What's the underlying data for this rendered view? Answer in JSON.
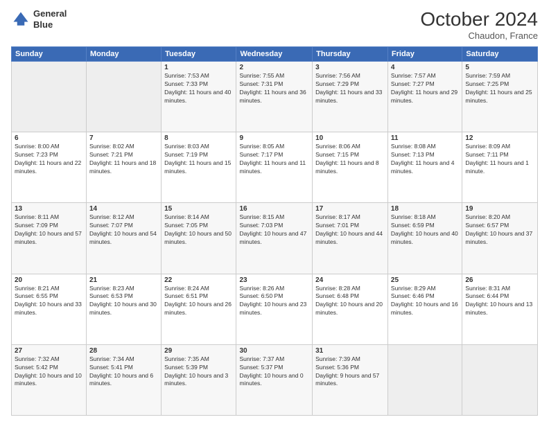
{
  "logo": {
    "line1": "General",
    "line2": "Blue"
  },
  "title": "October 2024",
  "location": "Chaudon, France",
  "days_header": [
    "Sunday",
    "Monday",
    "Tuesday",
    "Wednesday",
    "Thursday",
    "Friday",
    "Saturday"
  ],
  "weeks": [
    [
      {
        "day": "",
        "sunrise": "",
        "sunset": "",
        "daylight": ""
      },
      {
        "day": "",
        "sunrise": "",
        "sunset": "",
        "daylight": ""
      },
      {
        "day": "1",
        "sunrise": "Sunrise: 7:53 AM",
        "sunset": "Sunset: 7:33 PM",
        "daylight": "Daylight: 11 hours and 40 minutes."
      },
      {
        "day": "2",
        "sunrise": "Sunrise: 7:55 AM",
        "sunset": "Sunset: 7:31 PM",
        "daylight": "Daylight: 11 hours and 36 minutes."
      },
      {
        "day": "3",
        "sunrise": "Sunrise: 7:56 AM",
        "sunset": "Sunset: 7:29 PM",
        "daylight": "Daylight: 11 hours and 33 minutes."
      },
      {
        "day": "4",
        "sunrise": "Sunrise: 7:57 AM",
        "sunset": "Sunset: 7:27 PM",
        "daylight": "Daylight: 11 hours and 29 minutes."
      },
      {
        "day": "5",
        "sunrise": "Sunrise: 7:59 AM",
        "sunset": "Sunset: 7:25 PM",
        "daylight": "Daylight: 11 hours and 25 minutes."
      }
    ],
    [
      {
        "day": "6",
        "sunrise": "Sunrise: 8:00 AM",
        "sunset": "Sunset: 7:23 PM",
        "daylight": "Daylight: 11 hours and 22 minutes."
      },
      {
        "day": "7",
        "sunrise": "Sunrise: 8:02 AM",
        "sunset": "Sunset: 7:21 PM",
        "daylight": "Daylight: 11 hours and 18 minutes."
      },
      {
        "day": "8",
        "sunrise": "Sunrise: 8:03 AM",
        "sunset": "Sunset: 7:19 PM",
        "daylight": "Daylight: 11 hours and 15 minutes."
      },
      {
        "day": "9",
        "sunrise": "Sunrise: 8:05 AM",
        "sunset": "Sunset: 7:17 PM",
        "daylight": "Daylight: 11 hours and 11 minutes."
      },
      {
        "day": "10",
        "sunrise": "Sunrise: 8:06 AM",
        "sunset": "Sunset: 7:15 PM",
        "daylight": "Daylight: 11 hours and 8 minutes."
      },
      {
        "day": "11",
        "sunrise": "Sunrise: 8:08 AM",
        "sunset": "Sunset: 7:13 PM",
        "daylight": "Daylight: 11 hours and 4 minutes."
      },
      {
        "day": "12",
        "sunrise": "Sunrise: 8:09 AM",
        "sunset": "Sunset: 7:11 PM",
        "daylight": "Daylight: 11 hours and 1 minute."
      }
    ],
    [
      {
        "day": "13",
        "sunrise": "Sunrise: 8:11 AM",
        "sunset": "Sunset: 7:09 PM",
        "daylight": "Daylight: 10 hours and 57 minutes."
      },
      {
        "day": "14",
        "sunrise": "Sunrise: 8:12 AM",
        "sunset": "Sunset: 7:07 PM",
        "daylight": "Daylight: 10 hours and 54 minutes."
      },
      {
        "day": "15",
        "sunrise": "Sunrise: 8:14 AM",
        "sunset": "Sunset: 7:05 PM",
        "daylight": "Daylight: 10 hours and 50 minutes."
      },
      {
        "day": "16",
        "sunrise": "Sunrise: 8:15 AM",
        "sunset": "Sunset: 7:03 PM",
        "daylight": "Daylight: 10 hours and 47 minutes."
      },
      {
        "day": "17",
        "sunrise": "Sunrise: 8:17 AM",
        "sunset": "Sunset: 7:01 PM",
        "daylight": "Daylight: 10 hours and 44 minutes."
      },
      {
        "day": "18",
        "sunrise": "Sunrise: 8:18 AM",
        "sunset": "Sunset: 6:59 PM",
        "daylight": "Daylight: 10 hours and 40 minutes."
      },
      {
        "day": "19",
        "sunrise": "Sunrise: 8:20 AM",
        "sunset": "Sunset: 6:57 PM",
        "daylight": "Daylight: 10 hours and 37 minutes."
      }
    ],
    [
      {
        "day": "20",
        "sunrise": "Sunrise: 8:21 AM",
        "sunset": "Sunset: 6:55 PM",
        "daylight": "Daylight: 10 hours and 33 minutes."
      },
      {
        "day": "21",
        "sunrise": "Sunrise: 8:23 AM",
        "sunset": "Sunset: 6:53 PM",
        "daylight": "Daylight: 10 hours and 30 minutes."
      },
      {
        "day": "22",
        "sunrise": "Sunrise: 8:24 AM",
        "sunset": "Sunset: 6:51 PM",
        "daylight": "Daylight: 10 hours and 26 minutes."
      },
      {
        "day": "23",
        "sunrise": "Sunrise: 8:26 AM",
        "sunset": "Sunset: 6:50 PM",
        "daylight": "Daylight: 10 hours and 23 minutes."
      },
      {
        "day": "24",
        "sunrise": "Sunrise: 8:28 AM",
        "sunset": "Sunset: 6:48 PM",
        "daylight": "Daylight: 10 hours and 20 minutes."
      },
      {
        "day": "25",
        "sunrise": "Sunrise: 8:29 AM",
        "sunset": "Sunset: 6:46 PM",
        "daylight": "Daylight: 10 hours and 16 minutes."
      },
      {
        "day": "26",
        "sunrise": "Sunrise: 8:31 AM",
        "sunset": "Sunset: 6:44 PM",
        "daylight": "Daylight: 10 hours and 13 minutes."
      }
    ],
    [
      {
        "day": "27",
        "sunrise": "Sunrise: 7:32 AM",
        "sunset": "Sunset: 5:42 PM",
        "daylight": "Daylight: 10 hours and 10 minutes."
      },
      {
        "day": "28",
        "sunrise": "Sunrise: 7:34 AM",
        "sunset": "Sunset: 5:41 PM",
        "daylight": "Daylight: 10 hours and 6 minutes."
      },
      {
        "day": "29",
        "sunrise": "Sunrise: 7:35 AM",
        "sunset": "Sunset: 5:39 PM",
        "daylight": "Daylight: 10 hours and 3 minutes."
      },
      {
        "day": "30",
        "sunrise": "Sunrise: 7:37 AM",
        "sunset": "Sunset: 5:37 PM",
        "daylight": "Daylight: 10 hours and 0 minutes."
      },
      {
        "day": "31",
        "sunrise": "Sunrise: 7:39 AM",
        "sunset": "Sunset: 5:36 PM",
        "daylight": "Daylight: 9 hours and 57 minutes."
      },
      {
        "day": "",
        "sunrise": "",
        "sunset": "",
        "daylight": ""
      },
      {
        "day": "",
        "sunrise": "",
        "sunset": "",
        "daylight": ""
      }
    ]
  ]
}
